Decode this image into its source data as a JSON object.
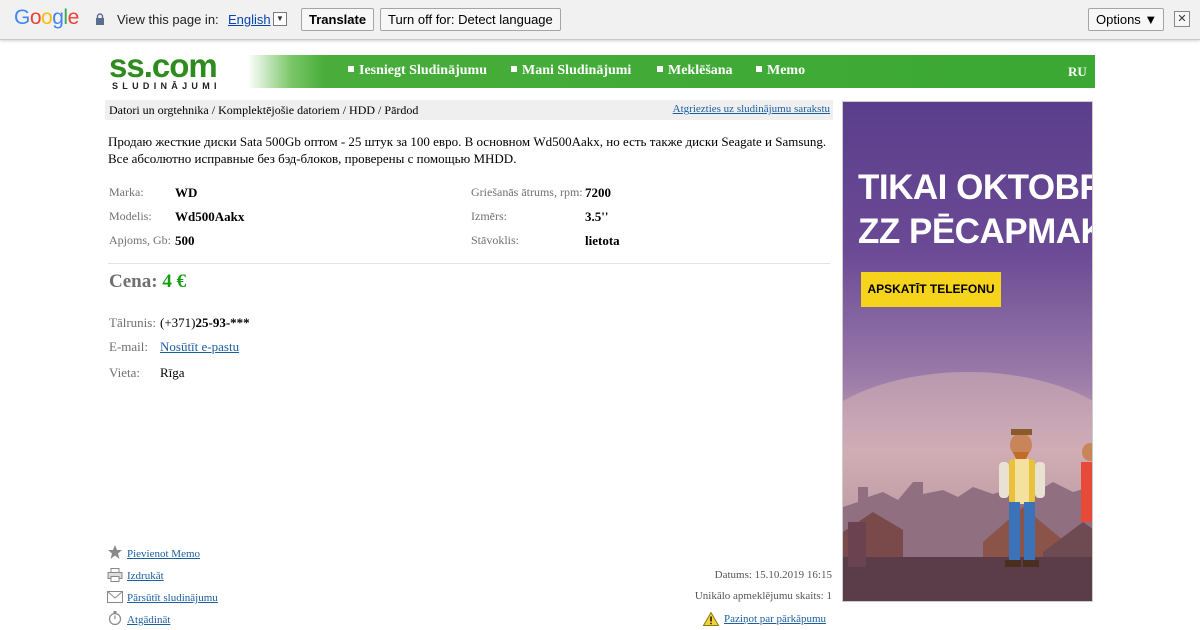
{
  "translate_bar": {
    "logo": "Google",
    "view_text": "View this page in:",
    "language": "English",
    "translate_button": "Translate",
    "turn_off_button": "Turn off for: Detect language",
    "options_button": "Options ▼",
    "close": "✕"
  },
  "header": {
    "logo_main": "ss.com",
    "logo_sub": "SLUDINĀJUMI",
    "nav": [
      "Iesniegt Sludinājumu",
      "Mani Sludinājumi",
      "Meklēšana",
      "Memo"
    ],
    "lang": "RU"
  },
  "breadcrumb": {
    "path": "Datori un orgtehnika / Komplektējošie datoriem / HDD / Pārdod",
    "back_link": "Atgriezties uz sludinājumu sarakstu"
  },
  "listing": {
    "description": "Продаю жесткие диски Sata 500Gb оптом - 25 штук за 100 евро. В основном Wd500Aakx, но есть также диски Seagate и Samsung. Все абсолютно исправные без бэд-блоков, проверены с помощью MHDD.",
    "attributes_left": [
      {
        "label": "Marka:",
        "value": "WD"
      },
      {
        "label": "Modelis:",
        "value": "Wd500Aakx"
      },
      {
        "label": "Apjoms, Gb:",
        "value": "500"
      }
    ],
    "attributes_right": [
      {
        "label": "Griešanās ātrums, rpm:",
        "value": "7200"
      },
      {
        "label": "Izmērs:",
        "value": "3.5''"
      },
      {
        "label": "Stāvoklis:",
        "value": "lietota"
      }
    ],
    "price_label": "Cena:",
    "price_value": "4 €",
    "phone_label": "Tālrunis:",
    "phone_prefix": "(+371)",
    "phone_number": "25-93-***",
    "email_label": "E-mail:",
    "email_link": "Nosūtīt e-pastu",
    "location_label": "Vieta:",
    "location_value": "Rīga"
  },
  "actions": [
    {
      "label": "Pievienot Memo",
      "icon": "star-icon"
    },
    {
      "label": "Izdrukāt",
      "icon": "printer-icon"
    },
    {
      "label": "Pārsūtīt sludinājumu",
      "icon": "envelope-icon"
    },
    {
      "label": "Atgādināt",
      "icon": "stopwatch-icon"
    }
  ],
  "meta": {
    "date": "Datums: 15.10.2019 16:15",
    "views": "Unikālo apmeklējumu skaits: 1",
    "report_link": "Paziņot par pārkāpumu"
  },
  "ad": {
    "line1": "TIKAI OKTOBRĪ",
    "line2": "ZZ PĒCAPMAKSĀ",
    "button": "APSKATĪT TELEFONU"
  },
  "colors": {
    "brand_green": "#3aa833",
    "price_green": "#159d15",
    "link_blue": "#1a5e9e",
    "ad_yellow": "#f7d41c"
  }
}
